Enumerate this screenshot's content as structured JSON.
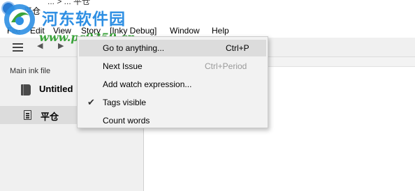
{
  "window": {
    "title": "平仓",
    "top_fragment": "... > ... 平仓"
  },
  "watermark": {
    "title": "河东软件园",
    "url": "www.pc0359.cn"
  },
  "menubar": {
    "items": [
      "File",
      "Edit",
      "View",
      "Story",
      "[Inky Debug]",
      "Window",
      "Help"
    ]
  },
  "toolbar": {
    "menu_icon": "hamburger-icon",
    "back_icon": "triangle-left-icon",
    "forward_icon": "triangle-right-icon"
  },
  "sidebar": {
    "heading": "Main ink file",
    "main_file": "Untitled",
    "selected_file": "平仓"
  },
  "story_menu": {
    "items": [
      {
        "label": "Go to anything...",
        "shortcut": "Ctrl+P",
        "highlighted": true
      },
      {
        "label": "Next Issue",
        "shortcut": "Ctrl+Period",
        "disabled_shortcut": true
      },
      {
        "label": "Add watch expression..."
      },
      {
        "label": "Tags visible",
        "checked": true
      },
      {
        "label": "Count words"
      }
    ]
  },
  "colors": {
    "watermark_blue": "#2e8fe3",
    "watermark_green": "#3aa33a",
    "sidebar_bg": "#f0f0f0",
    "menu_highlight": "#dcdcdc"
  }
}
